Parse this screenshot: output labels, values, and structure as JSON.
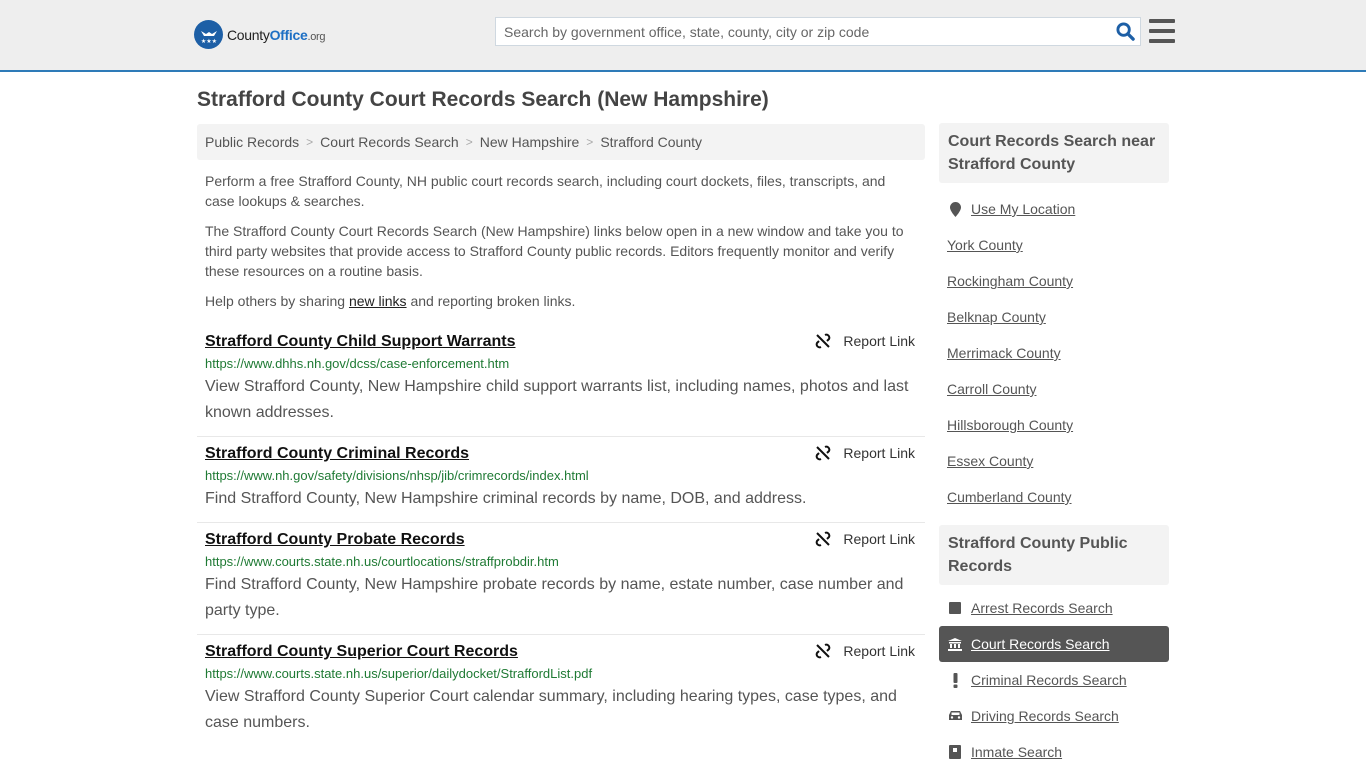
{
  "header": {
    "logo": {
      "brand_part1": "County",
      "brand_part2": "Office",
      "brand_suffix": ".org"
    },
    "search": {
      "placeholder": "Search by government office, state, county, city or zip code",
      "value": ""
    }
  },
  "page_title": "Strafford County Court Records Search (New Hampshire)",
  "breadcrumb": [
    {
      "label": "Public Records"
    },
    {
      "label": "Court Records Search"
    },
    {
      "label": "New Hampshire"
    },
    {
      "label": "Strafford County"
    }
  ],
  "intro": {
    "p1": "Perform a free Strafford County, NH public court records search, including court dockets, files, transcripts, and case lookups & searches.",
    "p2": "The Strafford County Court Records Search (New Hampshire) links below open in a new window and take you to third party websites that provide access to Strafford County public records. Editors frequently monitor and verify these resources on a routine basis.",
    "p3_before": "Help others by sharing ",
    "p3_link": "new links",
    "p3_after": " and reporting broken links."
  },
  "report_label": "Report Link",
  "results": [
    {
      "title": "Strafford County Child Support Warrants",
      "url": "https://www.dhhs.nh.gov/dcss/case-enforcement.htm",
      "description": "View Strafford County, New Hampshire child support warrants list, including names, photos and last known addresses."
    },
    {
      "title": "Strafford County Criminal Records",
      "url": "https://www.nh.gov/safety/divisions/nhsp/jib/crimrecords/index.html",
      "description": "Find Strafford County, New Hampshire criminal records by name, DOB, and address."
    },
    {
      "title": "Strafford County Probate Records",
      "url": "https://www.courts.state.nh.us/courtlocations/straffprobdir.htm",
      "description": "Find Strafford County, New Hampshire probate records by name, estate number, case number and party type."
    },
    {
      "title": "Strafford County Superior Court Records",
      "url": "https://www.courts.state.nh.us/superior/dailydocket/StraffordList.pdf",
      "description": "View Strafford County Superior Court calendar summary, including hearing types, case types, and case numbers."
    }
  ],
  "sidebar": {
    "nearby": {
      "heading": "Court Records Search near Strafford County",
      "use_location": "Use My Location",
      "items": [
        "York County",
        "Rockingham County",
        "Belknap County",
        "Merrimack County",
        "Carroll County",
        "Hillsborough County",
        "Essex County",
        "Cumberland County"
      ]
    },
    "public_records": {
      "heading": "Strafford County Public Records",
      "items": [
        {
          "label": "Arrest Records Search",
          "icon": "square-icon",
          "active": false
        },
        {
          "label": "Court Records Search",
          "icon": "courthouse-icon",
          "active": true
        },
        {
          "label": "Criminal Records Search",
          "icon": "exclamation-icon",
          "active": false
        },
        {
          "label": "Driving Records Search",
          "icon": "car-icon",
          "active": false
        },
        {
          "label": "Inmate Search",
          "icon": "inmate-icon",
          "active": false
        }
      ]
    }
  }
}
